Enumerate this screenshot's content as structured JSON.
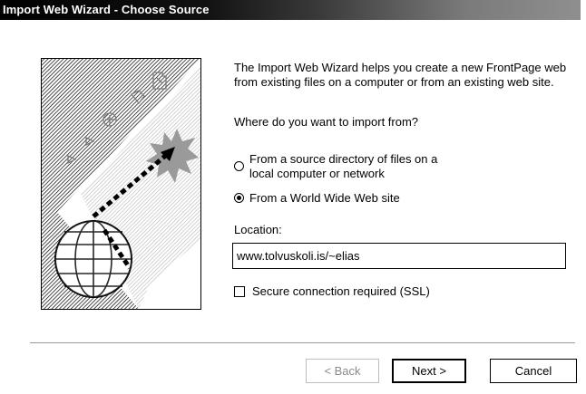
{
  "window": {
    "title": "Import Web Wizard - Choose Source"
  },
  "intro_text": "The Import Web Wizard helps you create a new FrontPage web from existing files on a computer or from an existing web site.",
  "question": "Where do you want to import from?",
  "options": [
    {
      "label_line1": "From a source directory of files on a",
      "label_line2": "local computer or network",
      "selected": false
    },
    {
      "label": "From a World Wide Web site",
      "selected": true
    }
  ],
  "location": {
    "label": "Location:",
    "value": "www.tolvuskoli.is/~elias"
  },
  "ssl": {
    "label": "Secure connection required (SSL)",
    "checked": false
  },
  "buttons": {
    "back": "< Back",
    "next": "Next >",
    "cancel": "Cancel"
  }
}
